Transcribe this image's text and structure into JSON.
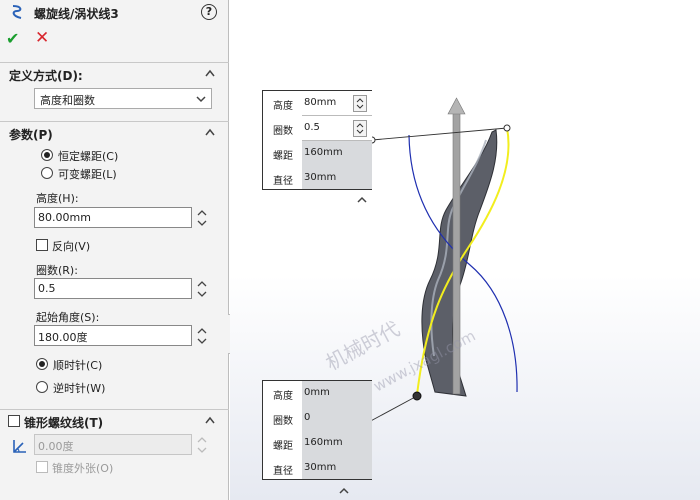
{
  "feature": {
    "title": "螺旋线/涡状线3",
    "icon": "helix-icon",
    "help_icon": "?",
    "ok_icon": "✔",
    "cancel_icon": "✕"
  },
  "definition": {
    "header": "定义方式(D):",
    "selected": "高度和圈数"
  },
  "params": {
    "header": "参数(P)",
    "constant_pitch": "恒定螺距(C)",
    "variable_pitch": "可变螺距(L)",
    "height_label": "高度(H):",
    "height_value": "80.00mm",
    "reverse_label": "反向(V)",
    "revolutions_label": "圈数(R):",
    "revolutions_value": "0.5",
    "start_angle_label": "起始角度(S):",
    "start_angle_value": "180.00度",
    "clockwise": "顺时针(C)",
    "counterclockwise": "逆时针(W)"
  },
  "taper": {
    "header": "锥形螺纹线(T)",
    "angle_value": "0.00度",
    "taper_outward": "锥度外张(O)"
  },
  "callout_top": {
    "rows": [
      {
        "key": "高度",
        "value": "80mm"
      },
      {
        "key": "圈数",
        "value": "0.5"
      },
      {
        "key": "螺距",
        "value": "160mm"
      },
      {
        "key": "直径",
        "value": "30mm"
      }
    ]
  },
  "callout_bottom": {
    "rows": [
      {
        "key": "高度",
        "value": "0mm"
      },
      {
        "key": "圈数",
        "value": "0"
      },
      {
        "key": "螺距",
        "value": "160mm"
      },
      {
        "key": "直径",
        "value": "30mm"
      }
    ]
  },
  "watermark": {
    "line1": "机械时代",
    "line2": "www.jxagl.com"
  },
  "colors": {
    "ok_green": "#1a9e2e",
    "cancel_red": "#d8262d",
    "helix_yellow": "#f2ee1e",
    "sketch_blue": "#1f2fb0",
    "axis_gray": "#9a9a9a"
  }
}
